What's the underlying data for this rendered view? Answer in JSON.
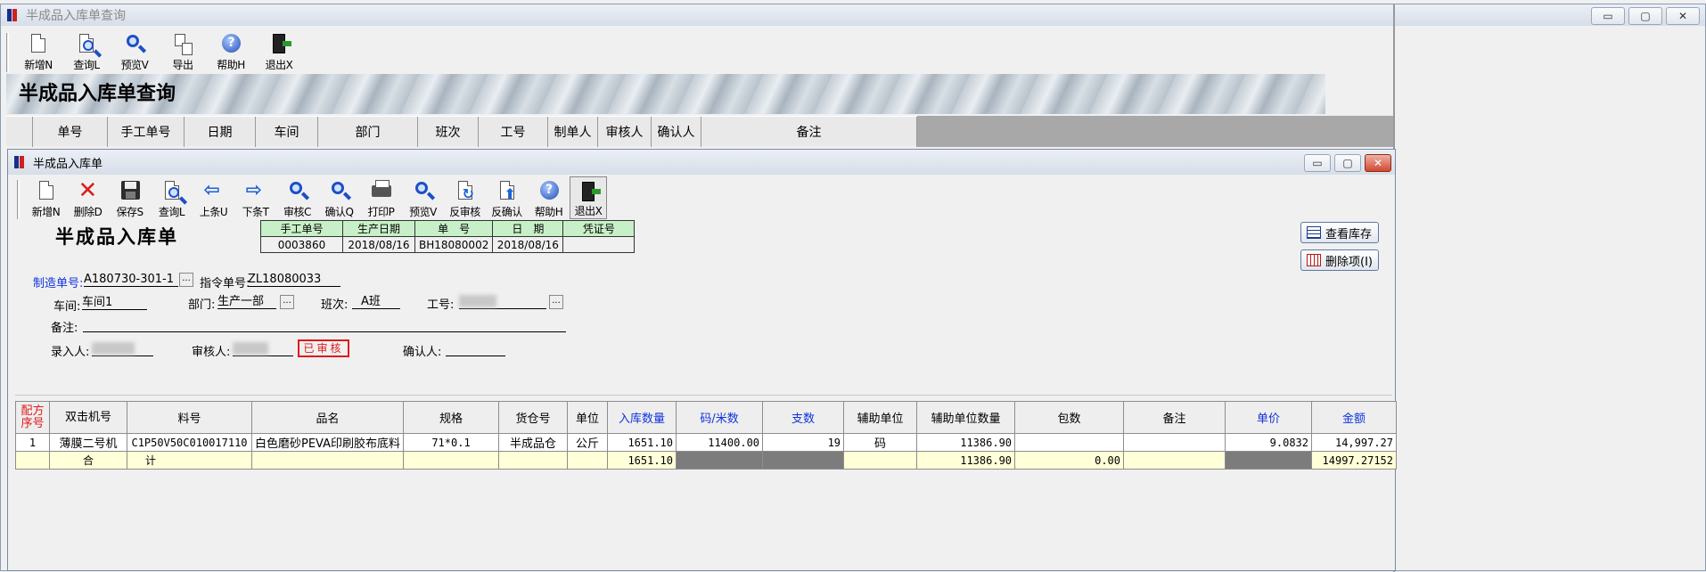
{
  "outer": {
    "title": "半成品入库单查询",
    "toolbar": [
      {
        "label": "新增N",
        "icon": "new-doc-icon"
      },
      {
        "label": "查询L",
        "icon": "query-doc-icon"
      },
      {
        "label": "预览V",
        "icon": "preview-icon"
      },
      {
        "label": "导出",
        "icon": "export-icon"
      },
      {
        "label": "帮助H",
        "icon": "help-icon"
      },
      {
        "label": "退出X",
        "icon": "exit-icon"
      }
    ],
    "banner_title": "半成品入库单查询",
    "columns": [
      "",
      "单号",
      "手工单号",
      "日期",
      "车间",
      "部门",
      "班次",
      "工号",
      "制单人",
      "审核人",
      "确认人",
      "备注"
    ]
  },
  "inner": {
    "title": "半成品入库单",
    "toolbar": [
      {
        "label": "新增N",
        "icon": "new-doc-icon"
      },
      {
        "label": "删除D",
        "icon": "delete-icon"
      },
      {
        "label": "保存S",
        "icon": "save-icon"
      },
      {
        "label": "查询L",
        "icon": "query-doc-icon"
      },
      {
        "label": "上条U",
        "icon": "prev-arrow-icon"
      },
      {
        "label": "下条T",
        "icon": "next-arrow-icon"
      },
      {
        "label": "审核C",
        "icon": "audit-icon"
      },
      {
        "label": "确认Q",
        "icon": "confirm-icon"
      },
      {
        "label": "打印P",
        "icon": "printer-icon"
      },
      {
        "label": "预览V",
        "icon": "preview-icon"
      },
      {
        "label": "反审核",
        "icon": "unaudit-icon"
      },
      {
        "label": "反确认",
        "icon": "unconfirm-icon"
      },
      {
        "label": "帮助H",
        "icon": "help-icon"
      },
      {
        "label": "退出X",
        "icon": "exit-icon"
      }
    ],
    "form_title": "半成品入库单",
    "header": {
      "labels": [
        "手工单号",
        "生产日期",
        "单　号",
        "日　期",
        "凭证号"
      ],
      "values": [
        "0003860",
        "2018/08/16",
        "BH18080002",
        "2018/08/16",
        ""
      ]
    },
    "fields": {
      "mfg_no_label": "制造单号:",
      "mfg_no": "A180730-301-1",
      "order_no_label": "指令单号:",
      "order_no": "ZL18080033",
      "workshop_label": "车间:",
      "workshop": "车间1",
      "dept_label": "部门:",
      "dept": "生产一部",
      "shift_label": "班次:",
      "shift": "A班",
      "worker_label": "工号:",
      "remark_label": "备注:",
      "entry_label": "录入人:",
      "auditor_label": "审核人:",
      "audited_stamp": "已审核",
      "confirmer_label": "确认人:"
    },
    "buttons": {
      "view_stock": "查看库存",
      "delete_item": "删除项(I)"
    },
    "detail": {
      "headers": [
        "配方序号",
        "双击机号",
        "料号",
        "品名",
        "规格",
        "货仓号",
        "单位",
        "入库数量",
        "码/米数",
        "支数",
        "辅助单位",
        "辅助单位数量",
        "包数",
        "备注",
        "单价",
        "金额"
      ],
      "rows": [
        [
          "1",
          "薄膜二号机",
          "C1P50V50C010017110",
          "白色磨砂PEVA印刷胶布底料",
          "71*0.1",
          "半成品仓",
          "公斤",
          "1651.10",
          "11400.00",
          "19",
          "码",
          "11386.90",
          "",
          "",
          "9.0832",
          "14,997.27"
        ]
      ],
      "total": {
        "label_a": "合",
        "label_b": "计",
        "qty": "1651.10",
        "aux_qty": "11386.90",
        "packs": "0.00",
        "amount": "14997.27152"
      }
    }
  }
}
